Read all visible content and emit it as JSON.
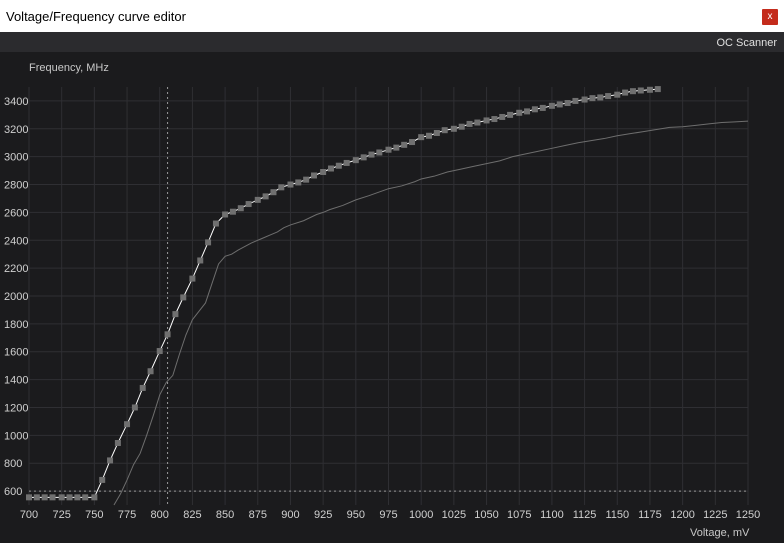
{
  "window": {
    "title": "Voltage/Frequency curve editor",
    "close_glyph": "x"
  },
  "toolbar": {
    "oc_scanner_label": "OC Scanner"
  },
  "chart_data": {
    "type": "line",
    "xlabel": "Voltage, mV",
    "ylabel": "Frequency, MHz",
    "xlim": [
      700,
      1250
    ],
    "ylim": [
      500,
      3500
    ],
    "x_ticks": [
      700,
      725,
      750,
      775,
      800,
      825,
      850,
      875,
      900,
      925,
      950,
      975,
      1000,
      1025,
      1050,
      1075,
      1100,
      1125,
      1150,
      1175,
      1200,
      1225,
      1250
    ],
    "y_ticks": [
      600,
      800,
      1000,
      1200,
      1400,
      1600,
      1800,
      2000,
      2200,
      2400,
      2600,
      2800,
      3000,
      3200,
      3400
    ],
    "grid": true,
    "cursor_crosshair": {
      "voltage": 806,
      "frequency": 600
    },
    "colors": {
      "background": "#1b1b1d",
      "grid": "#2f2f33",
      "curve": "#ffffff",
      "point": "#707070",
      "baseline": "#6e6e6e"
    },
    "series": [
      {
        "x": [
          700,
          706,
          712,
          718,
          725,
          731,
          737,
          743,
          750,
          756,
          762,
          768,
          775,
          781,
          787,
          793,
          800,
          806,
          812,
          818,
          825,
          831,
          837,
          843,
          850,
          856,
          862,
          868,
          875,
          881,
          887,
          893,
          900,
          906,
          912,
          918,
          925,
          931,
          937,
          943,
          950,
          956,
          962,
          968,
          975,
          981,
          987,
          993,
          1000,
          1006,
          1012,
          1018,
          1025,
          1031,
          1037,
          1043,
          1050,
          1056,
          1062,
          1068,
          1075,
          1081,
          1087,
          1093,
          1100,
          1106,
          1112,
          1118,
          1125,
          1131,
          1137,
          1143,
          1150,
          1156,
          1162,
          1168,
          1175,
          1181
        ],
        "y": [
          555,
          555,
          555,
          555,
          555,
          555,
          555,
          555,
          555,
          680,
          820,
          945,
          1080,
          1200,
          1340,
          1460,
          1605,
          1725,
          1870,
          1990,
          2125,
          2255,
          2385,
          2520,
          2585,
          2605,
          2630,
          2660,
          2690,
          2715,
          2745,
          2780,
          2800,
          2815,
          2835,
          2865,
          2890,
          2915,
          2935,
          2955,
          2975,
          2995,
          3015,
          3030,
          3050,
          3065,
          3085,
          3105,
          3140,
          3150,
          3170,
          3190,
          3200,
          3215,
          3235,
          3245,
          3260,
          3270,
          3285,
          3300,
          3315,
          3325,
          3340,
          3350,
          3365,
          3375,
          3385,
          3400,
          3410,
          3420,
          3425,
          3435,
          3445,
          3460,
          3470,
          3475,
          3480,
          3485
        ]
      },
      {
        "x": [
          765,
          770,
          775,
          780,
          785,
          790,
          795,
          800,
          805,
          810,
          815,
          820,
          825,
          830,
          835,
          840,
          845,
          850,
          855,
          860,
          865,
          870,
          875,
          880,
          885,
          890,
          895,
          900,
          910,
          920,
          925,
          930,
          940,
          950,
          960,
          975,
          985,
          995,
          1000,
          1010,
          1020,
          1030,
          1040,
          1050,
          1060,
          1070,
          1080,
          1090,
          1100,
          1110,
          1120,
          1130,
          1140,
          1150,
          1160,
          1170,
          1180,
          1190,
          1200,
          1210,
          1220,
          1230,
          1240,
          1250
        ],
        "y": [
          500,
          580,
          680,
          790,
          870,
          1000,
          1140,
          1290,
          1380,
          1430,
          1580,
          1720,
          1830,
          1890,
          1950,
          2090,
          2230,
          2285,
          2300,
          2330,
          2355,
          2380,
          2400,
          2420,
          2440,
          2460,
          2490,
          2510,
          2540,
          2585,
          2600,
          2620,
          2650,
          2690,
          2720,
          2770,
          2790,
          2820,
          2840,
          2860,
          2890,
          2910,
          2930,
          2950,
          2970,
          3000,
          3020,
          3040,
          3060,
          3080,
          3100,
          3115,
          3130,
          3150,
          3165,
          3180,
          3195,
          3210,
          3215,
          3225,
          3235,
          3245,
          3250,
          3255
        ]
      }
    ]
  }
}
